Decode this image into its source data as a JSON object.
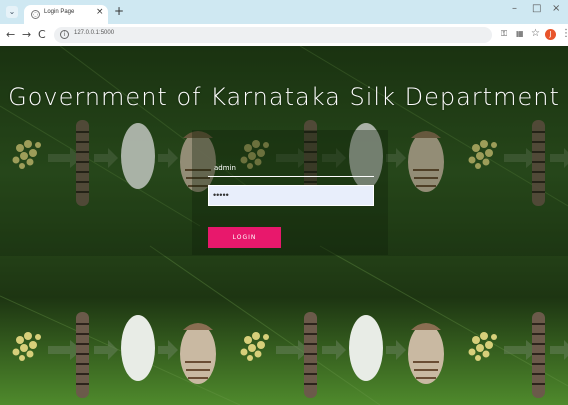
{
  "browser": {
    "tab_title": "Login Page",
    "tab_close": "×",
    "new_tab": "+",
    "url": "127.0.0.1:5000",
    "window_controls": {
      "minimize": "–",
      "maximize": "□",
      "close": "×"
    },
    "nav": {
      "back": "←",
      "forward": "→",
      "reload": "C"
    },
    "profile_initial": "J"
  },
  "page": {
    "title": "Government of Karnataka Silk Department",
    "login": {
      "username": "admin",
      "password_masked": "•••••",
      "button_label": "LOGIN"
    }
  },
  "colors": {
    "login_button": "#e8186c",
    "tab_strip": "#cfe8f2",
    "leaf_green": "#3d6b24"
  }
}
